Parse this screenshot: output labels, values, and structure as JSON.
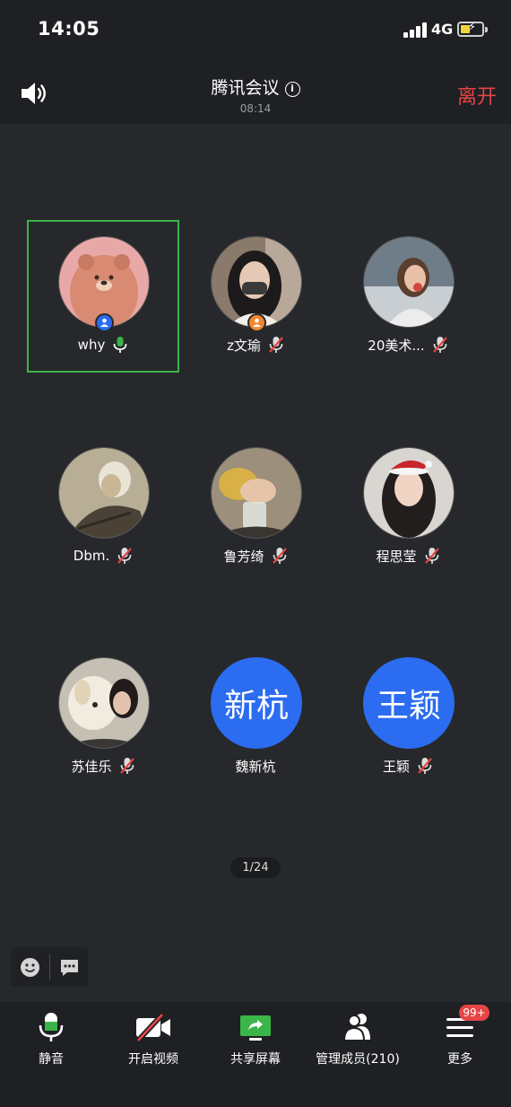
{
  "status_bar": {
    "time": "14:05",
    "network": "4G"
  },
  "header": {
    "title": "腾讯会议",
    "duration": "08:14",
    "leave_label": "离开"
  },
  "participants": [
    {
      "name": "why",
      "mic": "on",
      "role": "host",
      "avatar": "bear-photo",
      "speaking": true
    },
    {
      "name": "z文瑜",
      "mic": "muted",
      "role": "cohost",
      "avatar": "photo"
    },
    {
      "name": "20美术...",
      "mic": "muted",
      "avatar": "photo"
    },
    {
      "name": "Dbm.",
      "mic": "muted",
      "avatar": "photo"
    },
    {
      "name": "鲁芳绮",
      "mic": "muted",
      "avatar": "photo"
    },
    {
      "name": "程思莹",
      "mic": "muted",
      "avatar": "photo"
    },
    {
      "name": "苏佳乐",
      "mic": "muted",
      "avatar": "photo"
    },
    {
      "name": "魏新杭",
      "mic": "none",
      "avatar_text": "新杭"
    },
    {
      "name": "王颖",
      "mic": "muted",
      "avatar_text": "王颖"
    }
  ],
  "page_indicator": "1/24",
  "toolbar": {
    "mute_label": "静音",
    "video_label": "开启视频",
    "share_label": "共享屏幕",
    "members_label": "管理成员(210)",
    "more_label": "更多",
    "more_badge": "99+"
  },
  "colors": {
    "accent_green": "#3bb54a",
    "leave_red": "#e54545",
    "avatar_blue": "#2b6cf0"
  }
}
